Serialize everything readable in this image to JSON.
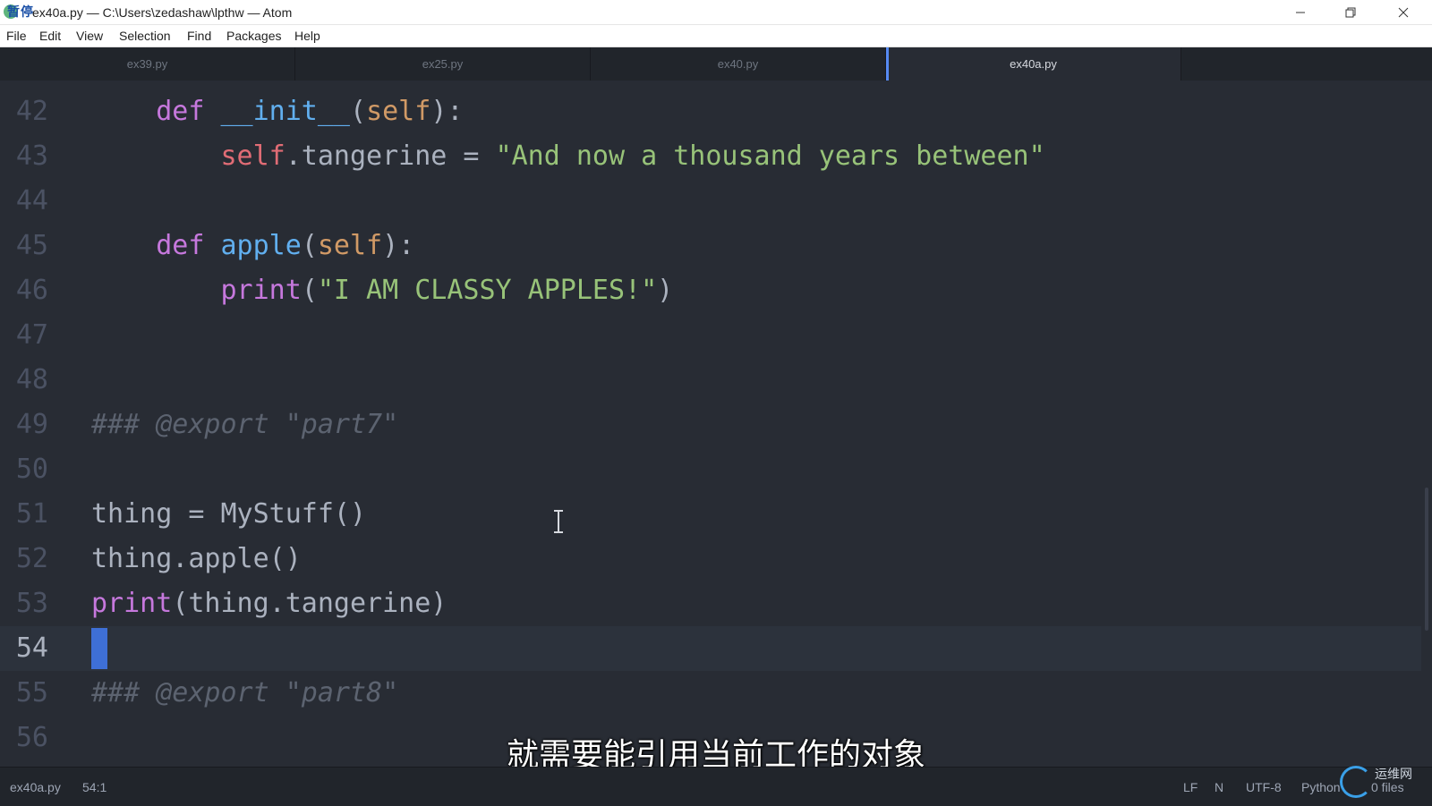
{
  "titlebar": {
    "overlay_text": "暂停",
    "title": "ex40a.py — C:\\Users\\zedashaw\\lpthw — Atom"
  },
  "menu": {
    "items": [
      {
        "label": "File"
      },
      {
        "label": "Edit"
      },
      {
        "label": "View"
      },
      {
        "label": "Selection"
      },
      {
        "label": "Find"
      },
      {
        "label": "Packages"
      },
      {
        "label": "Help"
      }
    ]
  },
  "tabs": [
    {
      "label": "ex39.py",
      "active": false
    },
    {
      "label": "ex25.py",
      "active": false
    },
    {
      "label": "ex40.py",
      "active": false
    },
    {
      "label": "ex40a.py",
      "active": true
    }
  ],
  "editor": {
    "partial_top_line": "41",
    "lines": [
      {
        "num": "42"
      },
      {
        "num": "43"
      },
      {
        "num": "44"
      },
      {
        "num": "45"
      },
      {
        "num": "46"
      },
      {
        "num": "47"
      },
      {
        "num": "48"
      },
      {
        "num": "49"
      },
      {
        "num": "50"
      },
      {
        "num": "51"
      },
      {
        "num": "52"
      },
      {
        "num": "53"
      },
      {
        "num": "54"
      },
      {
        "num": "55"
      },
      {
        "num": "56"
      }
    ],
    "code": {
      "l42_def": "def",
      "l42_init": "__init__",
      "l42_self": "self",
      "l43_self": "self",
      "l43_rest": ".tangerine = ",
      "l43_str": "\"And now a thousand years between\"",
      "l45_def": "def",
      "l45_fn": "apple",
      "l45_self": "self",
      "l46_print": "print",
      "l46_str": "\"I AM CLASSY APPLES!\"",
      "l49_comment": "### @export \"part7\"",
      "l51": "thing = MyStuff()",
      "l52": "thing.apple()",
      "l53_print": "print",
      "l53_rest": "(thing.tangerine)",
      "l55_comment": "### @export \"part8\""
    }
  },
  "subtitle": "就需要能引用当前工作的对象",
  "status": {
    "filename": "ex40a.py",
    "cursor_pos": "54:1",
    "line_ending": "LF",
    "indicator": "N",
    "encoding": "UTF-8",
    "grammar": "Python",
    "git_files": "0 files",
    "watermark": "运维网"
  },
  "colors": {
    "background": "#282c34",
    "keyword": "#c678dd",
    "function": "#61afef",
    "self": "#e06c75",
    "string": "#98c379",
    "comment": "#5c6370",
    "cursor": "#3e6fd6",
    "active_tab_indicator": "#568af2"
  }
}
